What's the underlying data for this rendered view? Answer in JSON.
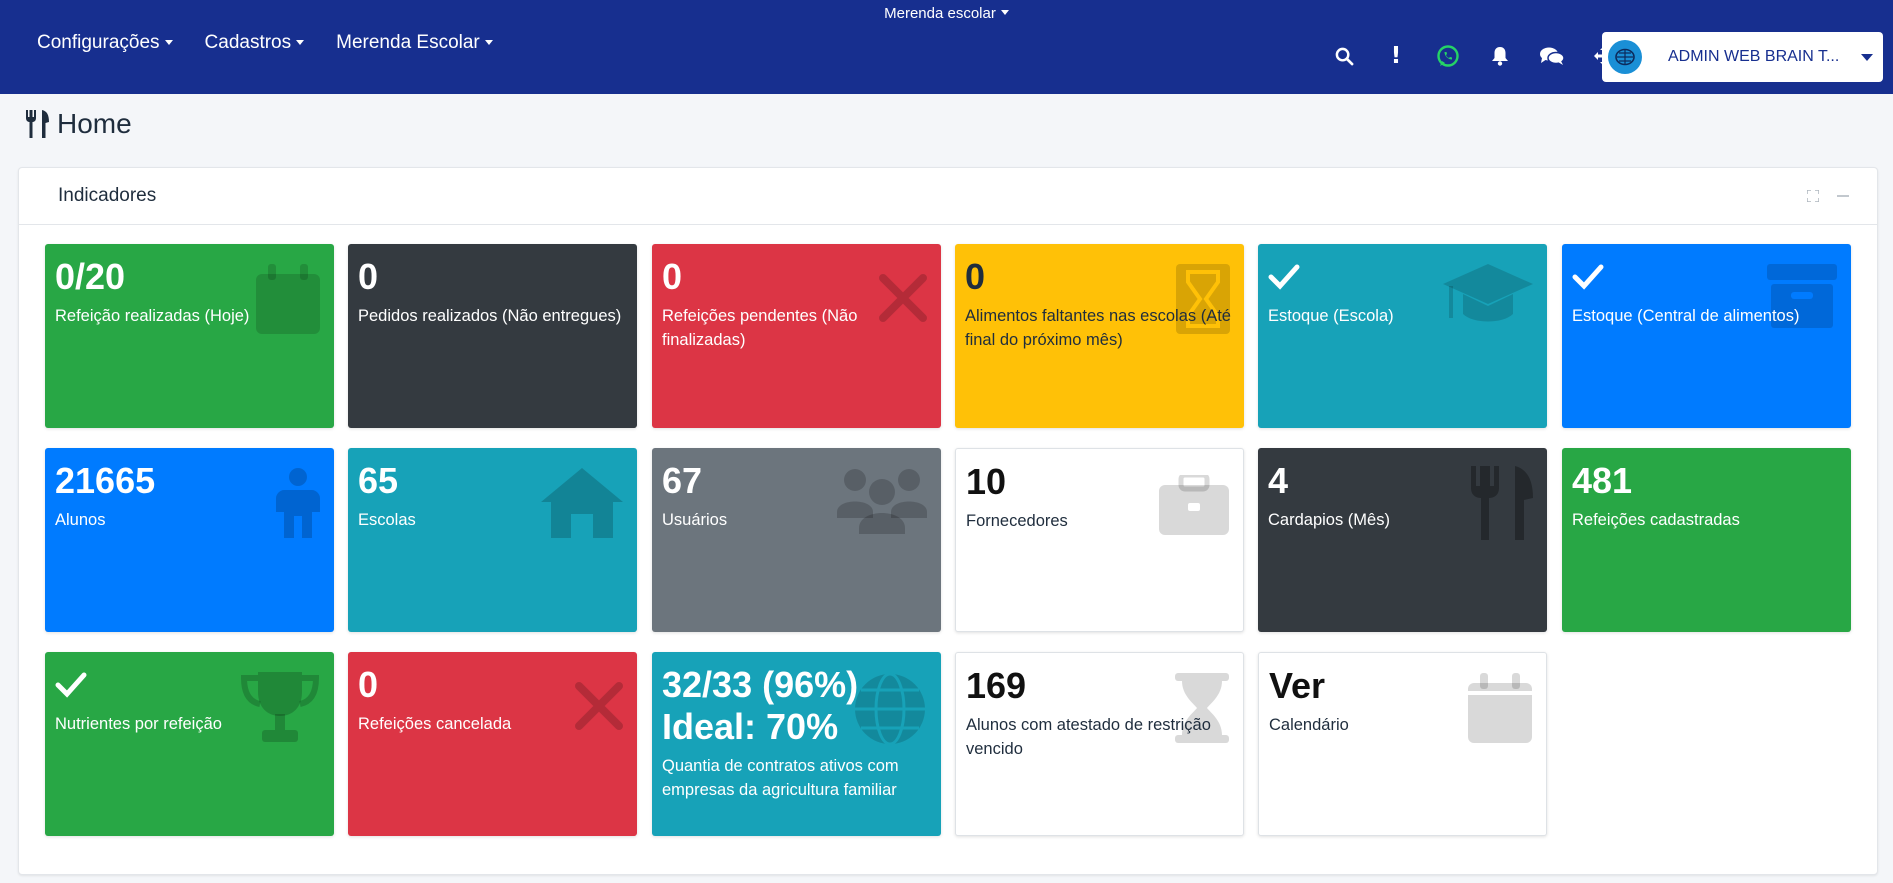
{
  "navbar": {
    "system_select": "Merenda escolar",
    "menu": [
      "Configurações",
      "Cadastros",
      "Merenda Escolar"
    ],
    "user_name": "ADMIN WEB BRAIN T...",
    "icons": [
      "search-icon",
      "alert-icon",
      "whatsapp-icon",
      "bell-icon",
      "chat-icon",
      "move-icon"
    ],
    "whatsapp_color": "#25d366",
    "alert_glyph": "!"
  },
  "page": {
    "title": "Home"
  },
  "card": {
    "title": "Indicadores"
  },
  "tiles": [
    {
      "value": "0/20",
      "label": "Refeição realizadas (Hoje)",
      "color": "green",
      "icon": "calendar-icon"
    },
    {
      "value": "0",
      "label": "Pedidos realizados (Não entregues)",
      "color": "dark",
      "icon": ""
    },
    {
      "value": "0",
      "label": "Refeições pendentes (Não finalizadas)",
      "color": "red",
      "icon": "x-icon"
    },
    {
      "value": "0",
      "label": "Alimentos faltantes nas escolas (Até final do próximo mês)",
      "color": "yellow",
      "icon": "hourglass-icon"
    },
    {
      "value": "",
      "label": "Estoque (Escola)",
      "color": "teal",
      "icon": "graduation-cap-icon",
      "check": true
    },
    {
      "value": "",
      "label": "Estoque (Central de alimentos)",
      "color": "blue",
      "icon": "archive-icon",
      "check": true
    },
    {
      "value": "21665",
      "label": "Alunos",
      "color": "blue",
      "icon": "person-icon"
    },
    {
      "value": "65",
      "label": "Escolas",
      "color": "teal",
      "icon": "home-icon"
    },
    {
      "value": "67",
      "label": "Usuários",
      "color": "gray",
      "icon": "users-icon"
    },
    {
      "value": "10",
      "label": "Fornecedores",
      "color": "white",
      "icon": "briefcase-icon"
    },
    {
      "value": "4",
      "label": "Cardapios (Mês)",
      "color": "dark",
      "icon": "utensils-icon"
    },
    {
      "value": "481",
      "label": "Refeições cadastradas",
      "color": "green",
      "icon": ""
    },
    {
      "value": "",
      "label": "Nutrientes por refeição",
      "color": "green",
      "icon": "trophy-icon",
      "check": true
    },
    {
      "value": "0",
      "label": "Refeições cancelada",
      "color": "red",
      "icon": "x-icon"
    },
    {
      "value": "32/33 (96%)",
      "value2": "Ideal: 70%",
      "label": "Quantia de contratos ativos com empresas da agricultura familiar",
      "color": "teal",
      "icon": "globe-icon"
    },
    {
      "value": "169",
      "label": "Alunos com atestado de restrição vencido",
      "color": "white",
      "icon": "hourglass-icon"
    },
    {
      "value": "Ver",
      "label": "Calendário",
      "color": "white",
      "icon": "calendar-icon"
    }
  ]
}
